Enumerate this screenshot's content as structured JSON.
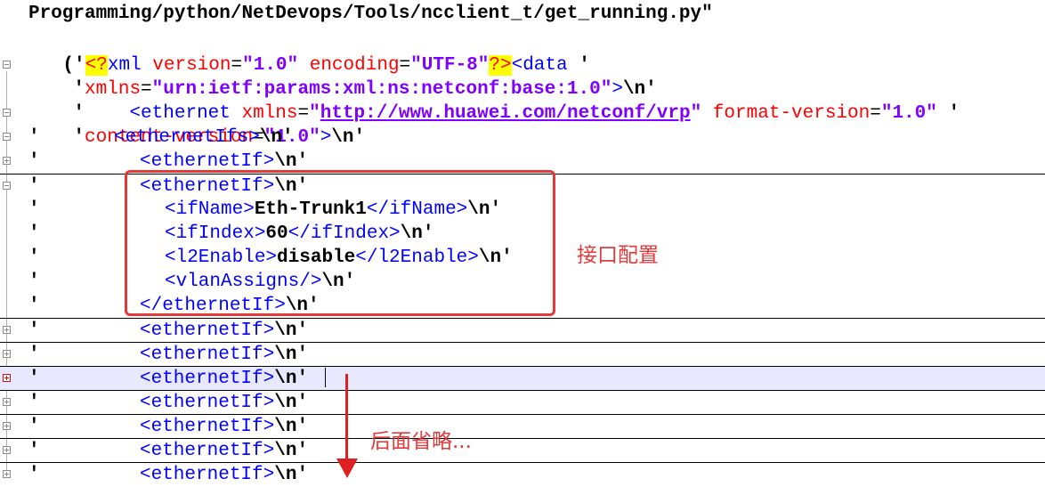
{
  "file_path": "Programming/python/NetDevops/Tools/ncclient_t/get_running.py\"",
  "lines": {
    "l1": {
      "open": "('",
      "pi_open": "<?",
      "tag": "xml",
      "a1": " version",
      "eq1": "=",
      "v1": "\"1.0\"",
      "a2": " encoding",
      "eq2": "=",
      "v2": "\"UTF-8\"",
      "pi_close": "?>",
      "tag2": "<data",
      "tail": " '"
    },
    "l2": {
      "q": "'",
      "attr": "xmlns",
      "eq": "=",
      "val": "\"urn:ietf:params:xml:ns:netconf:base:1.0\"",
      "close": ">",
      "nl": "\\n",
      "end": "'"
    },
    "l3": {
      "q": "'",
      "indent": "    ",
      "tag": "<ethernet",
      "a1": " xmlns",
      "eq1": "=",
      "q1": "\"",
      "url": "http://www.huawei.com/netconf/vrp",
      "q2": "\"",
      "a2": " format-version",
      "eq2": "=",
      "v2": "\"1.0\"",
      "tail": " '"
    },
    "l4": {
      "q": "'",
      "attr": "content-version",
      "eq": "=",
      "val": "\"1.0\"",
      "close": ">",
      "nl": "\\n",
      "end": "'"
    },
    "l5": {
      "q": "'",
      "tag": "<ethernetIfs>",
      "nl": "\\n",
      "end": "'"
    },
    "l6": {
      "q": "'",
      "tag": "<ethernetIf>",
      "nl": "\\n",
      "end": "'"
    },
    "l7": {
      "q": "'",
      "tag": "<ethernetIf>",
      "nl": "\\n",
      "end": "'"
    },
    "l8": {
      "q": "'",
      "open": "<ifName>",
      "text": "Eth-Trunk1",
      "close": "</ifName>",
      "nl": "\\n",
      "end": "'"
    },
    "l9": {
      "q": "'",
      "open": "<ifIndex>",
      "text": "60",
      "close": "</ifIndex>",
      "nl": "\\n",
      "end": "'"
    },
    "l10": {
      "q": "'",
      "open": "<l2Enable>",
      "text": "disable",
      "close": "</l2Enable>",
      "nl": "\\n",
      "end": "'"
    },
    "l11": {
      "q": "'",
      "tag": "<vlanAssigns/>",
      "nl": "\\n",
      "end": "'"
    },
    "l12": {
      "q": "'",
      "tag": "</ethernetIf>",
      "nl": "\\n",
      "end": "'"
    },
    "l13": {
      "q": "'",
      "tag": "<ethernetIf>",
      "nl": "\\n",
      "end": "'"
    },
    "l14": {
      "q": "'",
      "tag": "<ethernetIf>",
      "nl": "\\n",
      "end": "'"
    },
    "l15": {
      "q": "'",
      "tag": "<ethernetIf>",
      "nl": "\\n",
      "end": "'"
    },
    "l16": {
      "q": "'",
      "tag": "<ethernetIf>",
      "nl": "\\n",
      "end": "'"
    },
    "l17": {
      "q": "'",
      "tag": "<ethernetIf>",
      "nl": "\\n",
      "end": "'"
    },
    "l18": {
      "q": "'",
      "tag": "<ethernetIf>",
      "nl": "\\n",
      "end": "'"
    },
    "l19": {
      "q": "'",
      "tag": "<ethernetIf>",
      "nl": "\\n",
      "end": "'"
    }
  },
  "annotations": {
    "interface_config": "接口配置",
    "omitted": "后面省略..."
  },
  "colors": {
    "tag": "#0000ff",
    "attribute": "#ff0000",
    "value": "#8000ff",
    "annotation": "#e23a3a",
    "current_line": "#e8e8ff"
  }
}
